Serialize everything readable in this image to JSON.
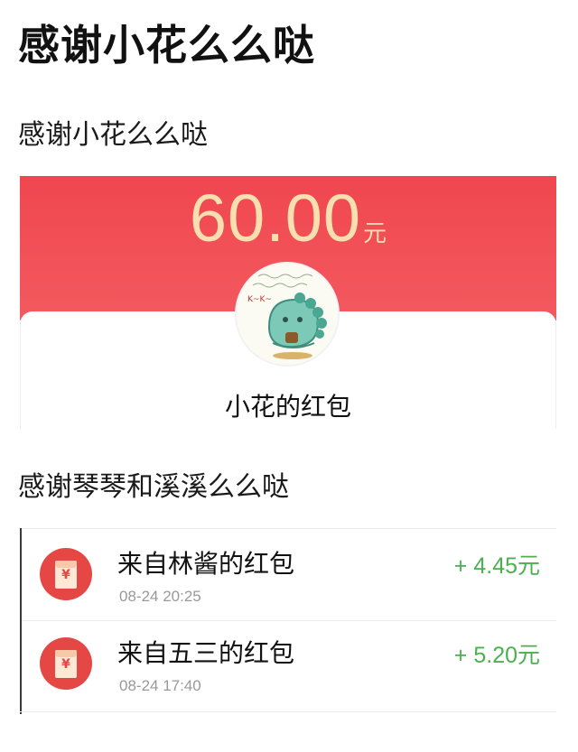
{
  "header": {
    "title": "感谢小花么么哒",
    "subtitle": "感谢小花么么哒"
  },
  "packet": {
    "amount": "60.00",
    "unit": "元",
    "sender": "小花的红包",
    "avatar": "dinosaur-avatar"
  },
  "section2": {
    "title": "感谢琴琴和溪溪么么哒"
  },
  "records": [
    {
      "title": "来自林酱的红包",
      "time": "08-24 20:25",
      "amount": "+ 4.45元",
      "icon": "red-envelope-icon"
    },
    {
      "title": "来自五三的红包",
      "time": "08-24 17:40",
      "amount": "+ 5.20元",
      "icon": "red-envelope-icon"
    }
  ],
  "colors": {
    "packet_red": "#f04650",
    "amount_gold": "#f7dfb0",
    "plus_green": "#4caf50",
    "envelope_red": "#e54744"
  }
}
